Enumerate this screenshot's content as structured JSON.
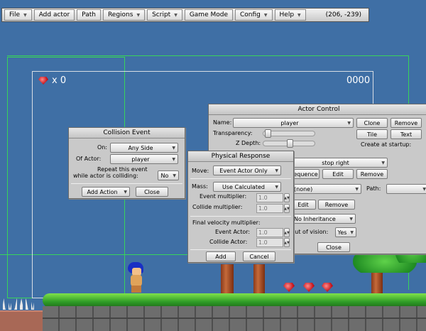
{
  "menubar": {
    "items": [
      {
        "label": "File"
      },
      {
        "label": "Add actor"
      },
      {
        "label": "Path"
      },
      {
        "label": "Regions"
      },
      {
        "label": "Script"
      },
      {
        "label": "Game Mode"
      },
      {
        "label": "Config"
      },
      {
        "label": "Help"
      }
    ],
    "coords": "(206, -239)"
  },
  "hud": {
    "gem_count": "x 0",
    "score": "0000"
  },
  "actor_control": {
    "title": "Actor Control",
    "name_label": "Name:",
    "name_value": "player",
    "transparency_label": "Transparency:",
    "zdepth_label": "Z Depth:",
    "clone": "Clone",
    "remove": "Remove",
    "tile": "Tile",
    "text": "Text",
    "create_at_startup": "Create at startup:",
    "animation_value": "stop right",
    "sequence": "Sequence",
    "edit": "Edit",
    "remove2": "Remove",
    "none_value": "(none)",
    "path_label": "Path:",
    "edit2": "Edit",
    "remove3": "Remove",
    "inheritance_value": "No Inheritance",
    "vision_label": "Out of vision:",
    "vision_value": "Yes",
    "close": "Close"
  },
  "collision_event": {
    "title": "Collision Event",
    "on_label": "On:",
    "on_value": "Any Side",
    "of_actor_label": "Of Actor:",
    "of_actor_value": "player",
    "repeat_label_1": "Repeat this event",
    "repeat_label_2": "while actor is colliding:",
    "repeat_value": "No",
    "add_action": "Add Action",
    "close": "Close"
  },
  "physical_response": {
    "title": "Physical Response",
    "move_label": "Move:",
    "move_value": "Event Actor Only",
    "mass_label": "Mass:",
    "mass_value": "Use Calculated",
    "event_mult_label": "Event multiplier:",
    "event_mult_value": "1.0",
    "collide_mult_label": "Collide multiplier:",
    "collide_mult_value": "1.0",
    "final_label": "Final velocity multiplier:",
    "event_actor_label": "Event Actor:",
    "event_actor_value": "1.0",
    "collide_actor_label": "Collide Actor:",
    "collide_actor_value": "1.0",
    "add": "Add",
    "cancel": "Cancel"
  }
}
